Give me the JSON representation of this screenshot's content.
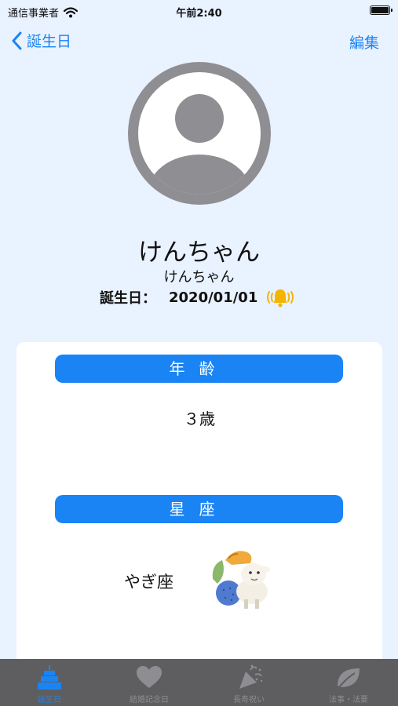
{
  "status_bar": {
    "carrier": "通信事業者",
    "time": "午前2:40"
  },
  "nav": {
    "back_label": "誕生日",
    "edit_label": "編集"
  },
  "profile": {
    "name": "けんちゃん",
    "furigana": "けんちゃん",
    "birthday_label": "誕生日：",
    "birthday_value": "2020/01/01"
  },
  "sections": {
    "age_header": "年齢",
    "age_value": "３歳",
    "zodiac_header": "星座",
    "zodiac_name": "やぎ座"
  },
  "tabs": [
    {
      "label": "誕生日",
      "icon": "cake-icon",
      "active": true
    },
    {
      "label": "結婚記念日",
      "icon": "heart-icon",
      "active": false
    },
    {
      "label": "長寿祝い",
      "icon": "party-popper-icon",
      "active": false
    },
    {
      "label": "法事・法要",
      "icon": "leaf-icon",
      "active": false
    }
  ],
  "colors": {
    "accent": "#1a84f5",
    "background": "#e9f2ff",
    "bell": "#f5b400",
    "tab_bar": "#5e5e60",
    "tab_inactive": "#8e8e92"
  }
}
